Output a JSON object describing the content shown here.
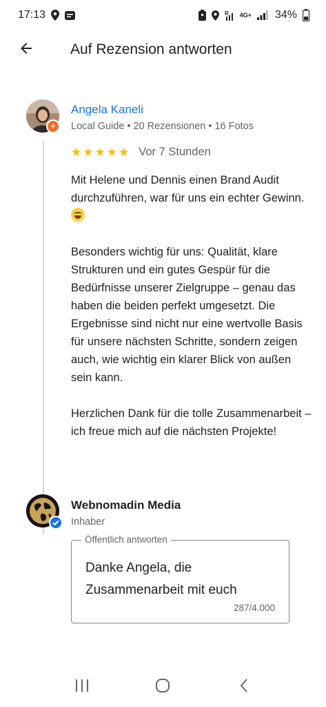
{
  "status_bar": {
    "time": "17:13",
    "battery": "34%",
    "network": "4G+",
    "icons_left": [
      "location-icon",
      "message-icon"
    ],
    "icons_right": [
      "battery-saver-icon",
      "location-icon",
      "wifi-calling-icon",
      "signal-icon"
    ]
  },
  "app_bar": {
    "title": "Auf Rezension antworten",
    "back_icon": "arrow-back-icon"
  },
  "review": {
    "reviewer_name": "Angela Kaneli",
    "reviewer_meta": "Local Guide • 20 Rezensionen • 16 Fotos",
    "rating": 5,
    "star_glyph": "★",
    "time_ago": "Vor 7 Stunden",
    "paragraph1": "Mit Helene und Dennis einen Brand Audit durchzuführen, war für uns ein echter Gewinn.",
    "paragraph2": "Besonders wichtig für uns: Qualität, klare Strukturen und ein gutes Gespür für die Bedürfnisse unserer Zielgruppe – genau das haben die beiden perfekt umgesetzt. Die Ergebnisse sind nicht nur eine wertvolle Basis für unsere nächsten Schritte, sondern zeigen auch, wie wichtig ein klarer Blick von außen sein kann.",
    "paragraph3": "Herzlichen Dank für die tolle Zusammenarbeit – ich freue mich auf die nächsten Projekte!"
  },
  "owner": {
    "name": "Webnomadin Media",
    "role": "Inhaber"
  },
  "reply": {
    "label": "Öffentlich antworten",
    "text": "Danke Angela, die Zusammenarbeit mit euch",
    "counter": "287/4.000"
  },
  "colors": {
    "link": "#1a73e8",
    "star": "#fbbc04",
    "guide_badge": "#f36b2b",
    "verified": "#1a73e8"
  },
  "nav_bar": {
    "icons": [
      "recent-apps-icon",
      "home-icon",
      "back-icon"
    ]
  }
}
